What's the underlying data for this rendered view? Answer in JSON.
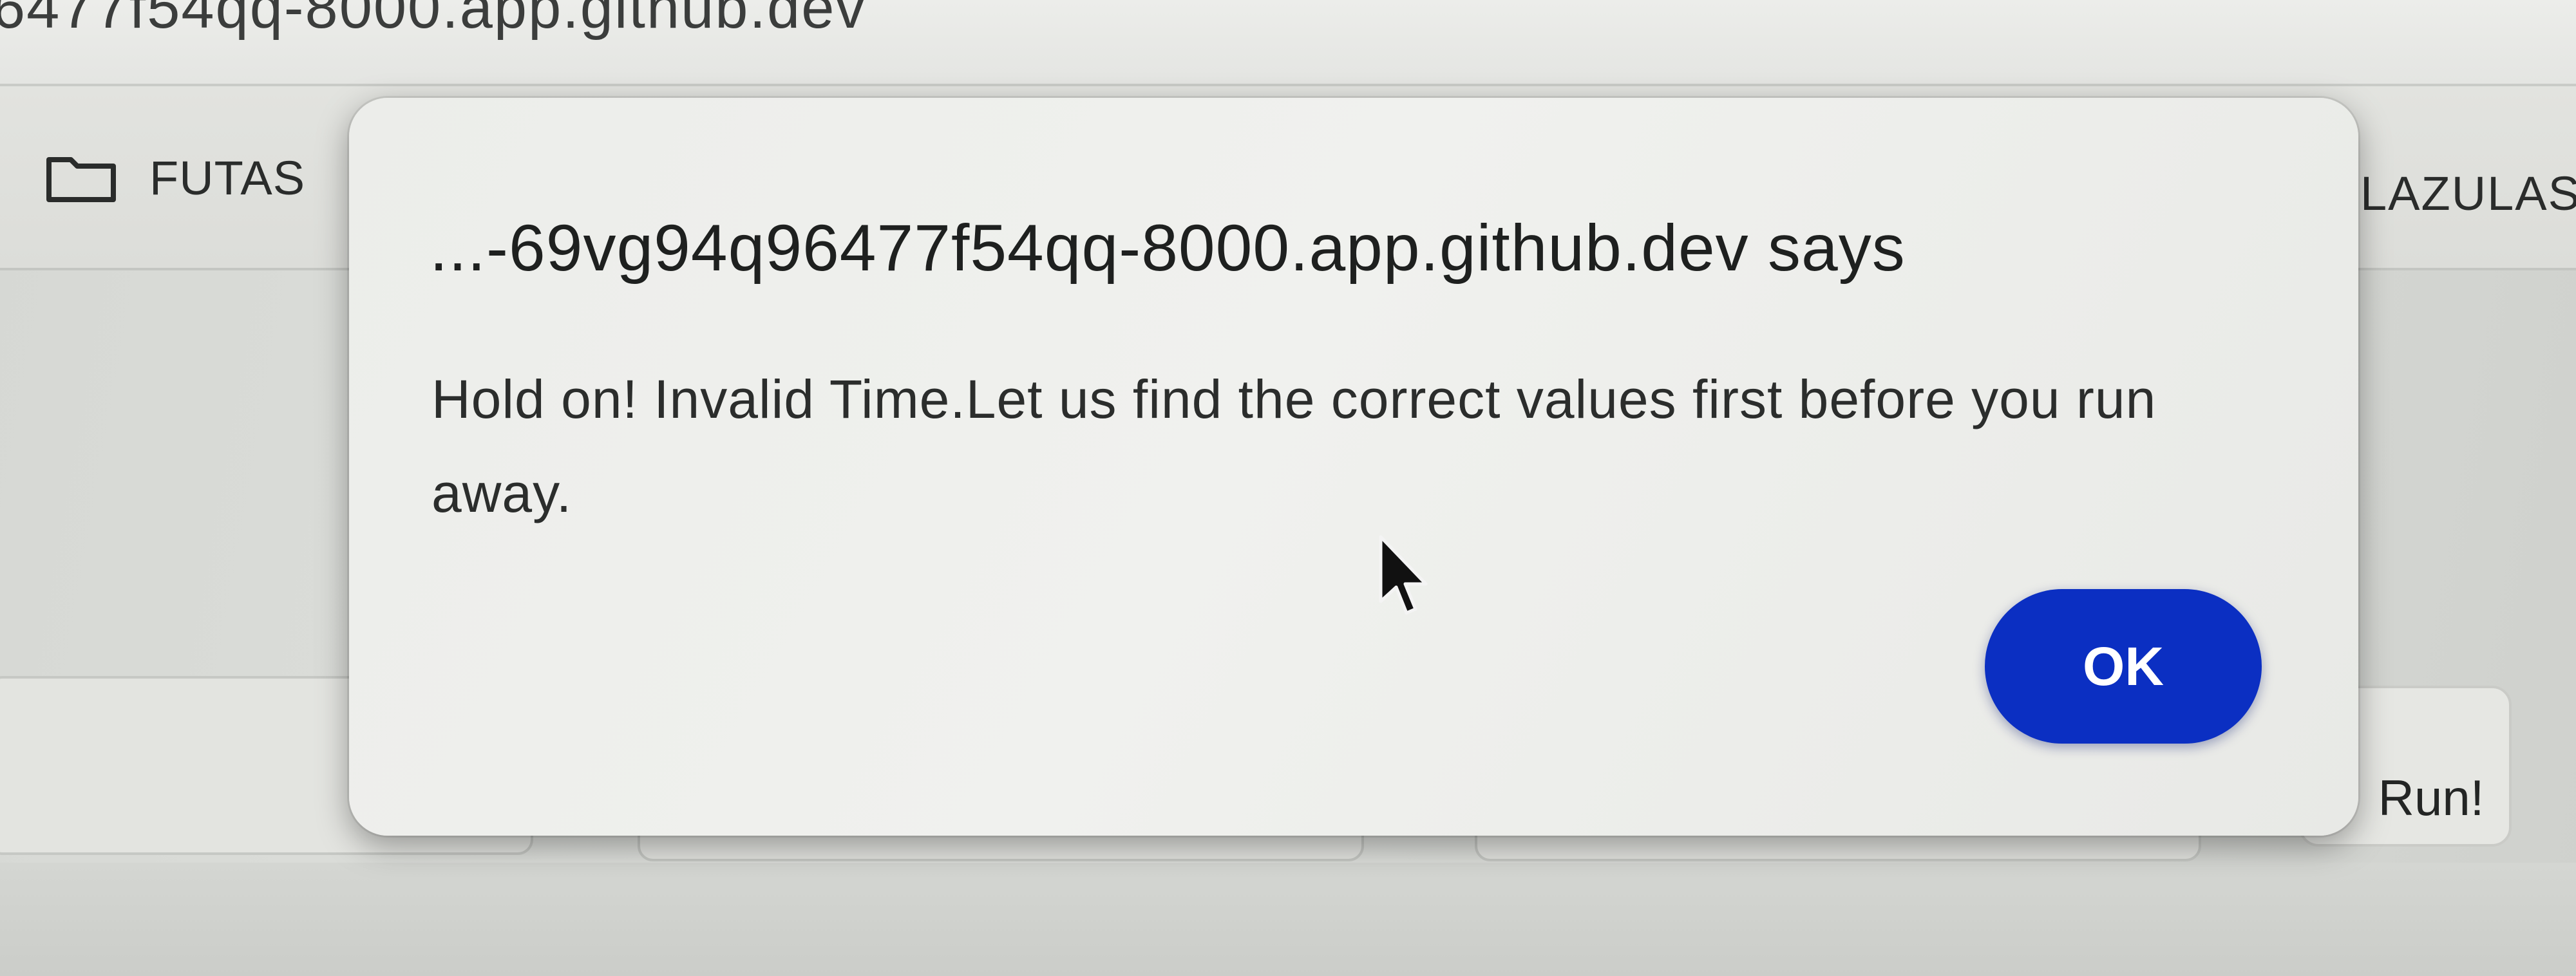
{
  "browser": {
    "url": "6477f54qq-8000.app.github.dev"
  },
  "toolbar": {
    "folder_label": "FUTAS",
    "right_tab_label": "LAZULAS"
  },
  "form": {
    "run_button_label": "Run!"
  },
  "dialog": {
    "title": "...-69vg94q96477f54qq-8000.app.github.dev says",
    "message": "Hold on! Invalid Time.Let us find the correct values first before you run away.",
    "ok_label": "OK"
  },
  "icons": {
    "folder": "folder-icon",
    "cursor": "mouse-pointer-icon"
  },
  "colors": {
    "ok_button": "#0b2fc2",
    "dialog_background": "#eeefec",
    "page_background": "#dcddd9"
  }
}
